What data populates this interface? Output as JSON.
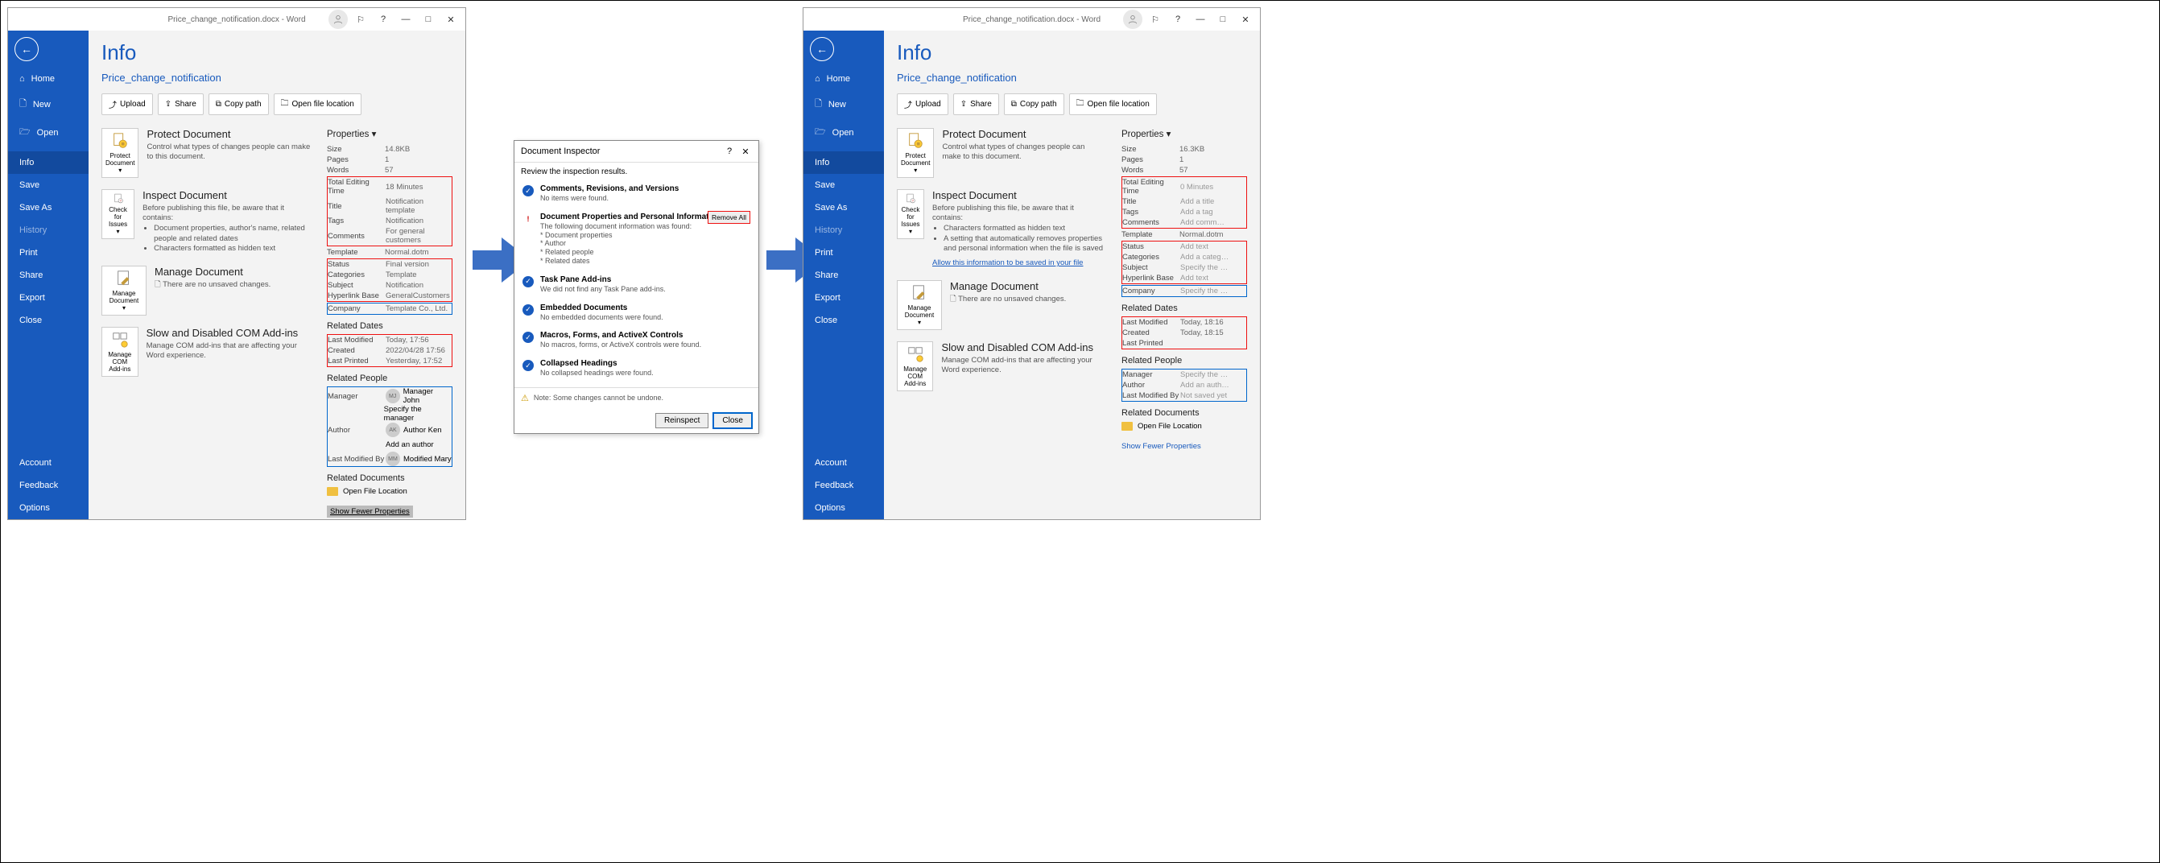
{
  "title_suffix": " - Word",
  "filename_display": "Price_change_notification.docx",
  "filename_link": "Price_change_notification",
  "backstage": {
    "info_heading": "Info",
    "nav": {
      "home": "Home",
      "new": "New",
      "open": "Open",
      "info": "Info",
      "save": "Save",
      "save_as": "Save As",
      "history": "History",
      "print": "Print",
      "share": "Share",
      "export": "Export",
      "close": "Close",
      "account": "Account",
      "feedback": "Feedback",
      "options": "Options"
    },
    "toolbar": {
      "upload": "Upload",
      "share": "Share",
      "copy_path": "Copy path",
      "open_location": "Open file location"
    },
    "protect": {
      "title": "Protect Document",
      "desc": "Control what types of changes people can make to this document.",
      "btn": "Protect Document"
    },
    "inspect": {
      "title": "Inspect Document",
      "lead": "Before publishing this file, be aware that it contains:",
      "btn": "Check for Issues"
    },
    "inspect_bullets_before": [
      "Document properties, author's name, related people and related dates",
      "Characters formatted as hidden text"
    ],
    "inspect_bullets_after": [
      "Characters formatted as hidden text",
      "A setting that automatically removes properties and personal information when the file is saved"
    ],
    "allow_save_link": "Allow this information to be saved in your file",
    "manage": {
      "title": "Manage Document",
      "desc": "There are no unsaved changes.",
      "btn": "Manage Document"
    },
    "com": {
      "title": "Slow and Disabled COM Add-ins",
      "desc": "Manage COM add-ins that are affecting your Word experience.",
      "btn": "Manage COM Add-ins"
    }
  },
  "props_header": "Properties",
  "related_dates": "Related Dates",
  "related_people": "Related People",
  "related_docs": "Related Documents",
  "open_file_loc": "Open File Location",
  "show_fewer": "Show Fewer Properties",
  "before": {
    "basic": [
      [
        "Size",
        "14.8KB"
      ],
      [
        "Pages",
        "1"
      ],
      [
        "Words",
        "57"
      ]
    ],
    "box1": [
      [
        "Total Editing Time",
        "18 Minutes"
      ],
      [
        "Title",
        "Notification template"
      ],
      [
        "Tags",
        "Notification"
      ],
      [
        "Comments",
        "For general customers"
      ]
    ],
    "template": [
      "Template",
      "Normal.dotm"
    ],
    "box2": [
      [
        "Status",
        "Final version"
      ],
      [
        "Categories",
        "Template"
      ],
      [
        "Subject",
        "Notification"
      ],
      [
        "Hyperlink Base",
        "GeneralCustomers"
      ]
    ],
    "company": [
      "Company",
      "Template Co., Ltd."
    ],
    "dates": [
      [
        "Last Modified",
        "Today, 17:56"
      ],
      [
        "Created",
        "2022/04/28 17:56"
      ],
      [
        "Last Printed",
        "Yesterday, 17:52"
      ]
    ],
    "people": {
      "manager": {
        "k": "Manager",
        "initials": "MJ",
        "name": "Manager John",
        "add": "Specify the manager"
      },
      "author": {
        "k": "Author",
        "initials": "AK",
        "name": "Author Ken",
        "add": "Add an author"
      },
      "lastmod": {
        "k": "Last Modified By",
        "initials": "MM",
        "name": "Modified Mary"
      }
    }
  },
  "after": {
    "basic": [
      [
        "Size",
        "16.3KB"
      ],
      [
        "Pages",
        "1"
      ],
      [
        "Words",
        "57"
      ]
    ],
    "box1": [
      [
        "Total Editing Time",
        "0 Minutes"
      ],
      [
        "Title",
        "Add a title"
      ],
      [
        "Tags",
        "Add a tag"
      ],
      [
        "Comments",
        "Add comm…"
      ]
    ],
    "template": [
      "Template",
      "Normal.dotm"
    ],
    "box2": [
      [
        "Status",
        "Add text"
      ],
      [
        "Categories",
        "Add a categ…"
      ],
      [
        "Subject",
        "Specify the …"
      ],
      [
        "Hyperlink Base",
        "Add text"
      ]
    ],
    "company": [
      "Company",
      "Specify the …"
    ],
    "dates": [
      [
        "Last Modified",
        "Today, 18:16"
      ],
      [
        "Created",
        "Today, 18:15"
      ],
      [
        "Last Printed",
        ""
      ]
    ],
    "people": [
      [
        "Manager",
        "Specify the …"
      ],
      [
        "Author",
        "Add an auth…"
      ],
      [
        "Last Modified By",
        "Not saved yet"
      ]
    ]
  },
  "dialog": {
    "title": "Document Inspector",
    "lead": "Review the inspection results.",
    "remove_all": "Remove All",
    "items": [
      {
        "icon": "ok",
        "title": "Comments, Revisions, and Versions",
        "body": "No items were found."
      },
      {
        "icon": "warn",
        "title": "Document Properties and Personal Information",
        "body": "The following document information was found:\n* Document properties\n* Author\n* Related people\n* Related dates",
        "remove": true
      },
      {
        "icon": "ok",
        "title": "Task Pane Add-ins",
        "body": "We did not find any Task Pane add-ins."
      },
      {
        "icon": "ok",
        "title": "Embedded Documents",
        "body": "No embedded documents were found."
      },
      {
        "icon": "ok",
        "title": "Macros, Forms, and ActiveX Controls",
        "body": "No macros, forms, or ActiveX controls were found."
      },
      {
        "icon": "ok",
        "title": "Collapsed Headings",
        "body": "No collapsed headings were found."
      }
    ],
    "note": "Note: Some changes cannot be undone.",
    "reinspect": "Reinspect",
    "close": "Close"
  }
}
